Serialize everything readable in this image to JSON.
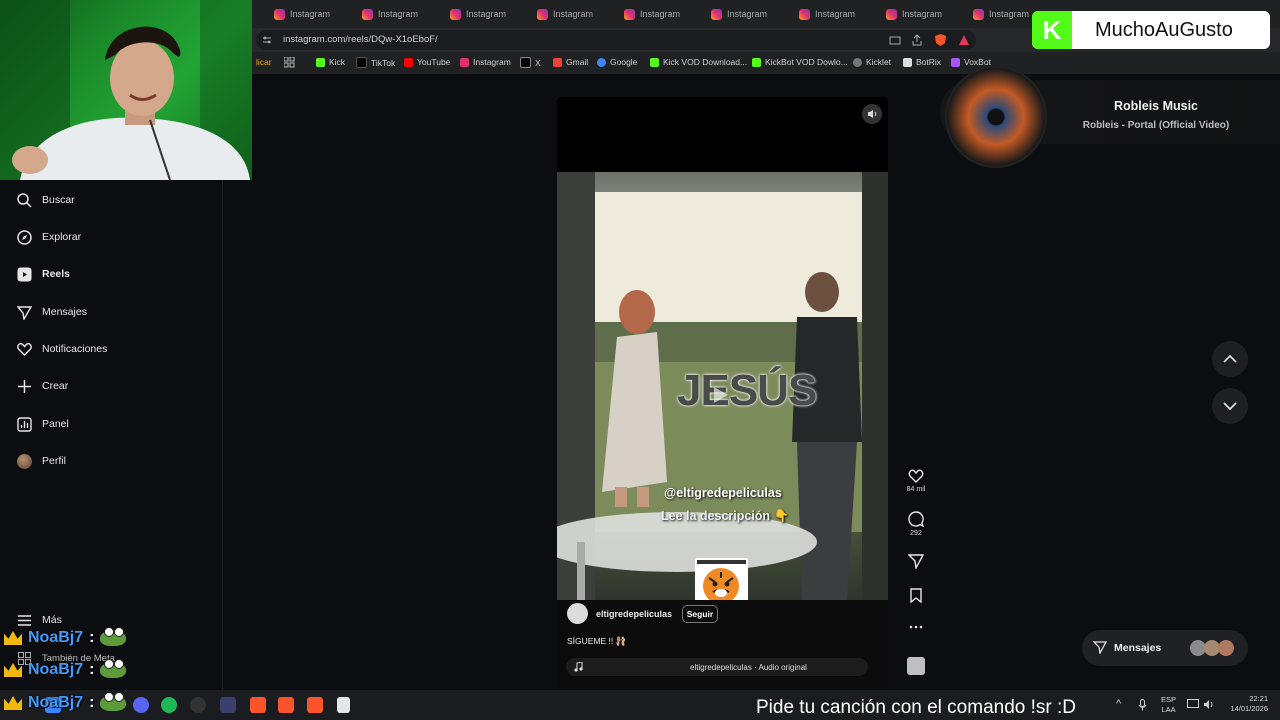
{
  "browser": {
    "tabs": [
      "Instagram",
      "Instagram",
      "Instagram",
      "Instagram",
      "Instagram",
      "Instagram",
      "Instagram",
      "Instagram",
      "Instagram"
    ],
    "url": "instagram.com/reels/DQw-X1oEboF/",
    "bookmarks": [
      {
        "label": "licar",
        "color": "#f0b000"
      },
      {
        "label": "Kick",
        "color": "#53fc18"
      },
      {
        "label": "TikTok",
        "color": "#222222"
      },
      {
        "label": "YouTube",
        "color": "#ff0000"
      },
      {
        "label": "Instagram",
        "color": "#e1306c"
      },
      {
        "label": "X",
        "color": "#000000"
      },
      {
        "label": "Gmail",
        "color": "#ea4335"
      },
      {
        "label": "Google",
        "color": "#4285f4"
      },
      {
        "label": "Kick VOD Download...",
        "color": "#53fc18"
      },
      {
        "label": "KickBot VOD Dowlo...",
        "color": "#53fc18"
      },
      {
        "label": "Kicklet",
        "color": "#777777"
      },
      {
        "label": "BotRix",
        "color": "#dddddd"
      },
      {
        "label": "VoxBot",
        "color": "#a855f7"
      }
    ]
  },
  "sidebar": {
    "items": [
      {
        "label": "Buscar",
        "icon": "search-icon"
      },
      {
        "label": "Explorar",
        "icon": "compass-icon"
      },
      {
        "label": "Reels",
        "icon": "reels-icon"
      },
      {
        "label": "Mensajes",
        "icon": "send-icon"
      },
      {
        "label": "Notificaciones",
        "icon": "heart-icon"
      },
      {
        "label": "Crear",
        "icon": "plus-icon"
      },
      {
        "label": "Panel",
        "icon": "chart-icon"
      },
      {
        "label": "Perfil",
        "icon": "avatar"
      }
    ],
    "more": "Más",
    "meta": "También de Meta"
  },
  "reel": {
    "overlay_title": "JESÚS",
    "handle_overlay": "@eltigredepeliculas",
    "desc_overlay": "Lee la descripción 👇",
    "username": "eltigredepeliculas",
    "follow": "Seguir",
    "caption": "SÍGUEME !! 🩰",
    "audio": "eltigredepeliculas · Audio original",
    "likes": "84 mil",
    "comments": "292"
  },
  "music": {
    "title": "Robleis Music",
    "song": "Robleis - Portal (Official Video)"
  },
  "kick": {
    "name": "MuchoAuGusto",
    "logo": "K"
  },
  "messages_pill": "Mensajes",
  "chat": [
    {
      "user": "NoaBj7",
      "sep": ":"
    },
    {
      "user": "NoaBj7",
      "sep": ":"
    },
    {
      "user": "NoaBj7",
      "sep": ":"
    }
  ],
  "ticker": "Pide tu canción con el comando !sr :D",
  "systray": {
    "lang1": "ESP",
    "lang2": "LAA",
    "time": "22:21",
    "date": "14/01/2026"
  }
}
